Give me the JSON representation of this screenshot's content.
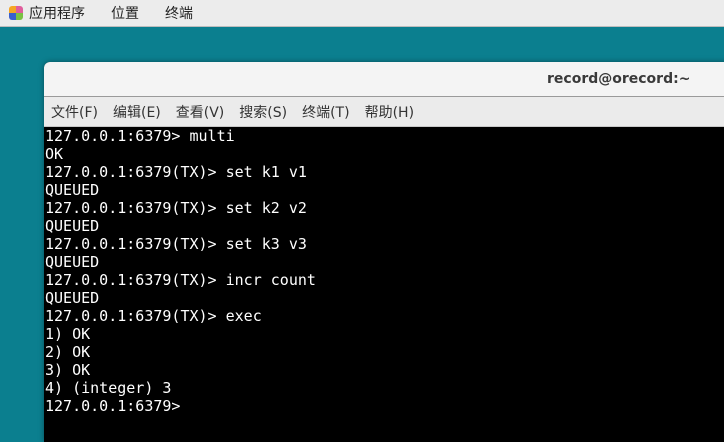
{
  "topbar": {
    "items": [
      "应用程序",
      "位置",
      "终端"
    ]
  },
  "window": {
    "title": "record@orecord:~",
    "menu": [
      "文件(F)",
      "编辑(E)",
      "查看(V)",
      "搜索(S)",
      "终端(T)",
      "帮助(H)"
    ]
  },
  "terminal": {
    "lines": [
      "127.0.0.1:6379> multi",
      "OK",
      "127.0.0.1:6379(TX)> set k1 v1",
      "QUEUED",
      "127.0.0.1:6379(TX)> set k2 v2",
      "QUEUED",
      "127.0.0.1:6379(TX)> set k3 v3",
      "QUEUED",
      "127.0.0.1:6379(TX)> incr count",
      "QUEUED",
      "127.0.0.1:6379(TX)> exec",
      "1) OK",
      "2) OK",
      "3) OK",
      "4) (integer) 3",
      "127.0.0.1:6379>"
    ]
  }
}
